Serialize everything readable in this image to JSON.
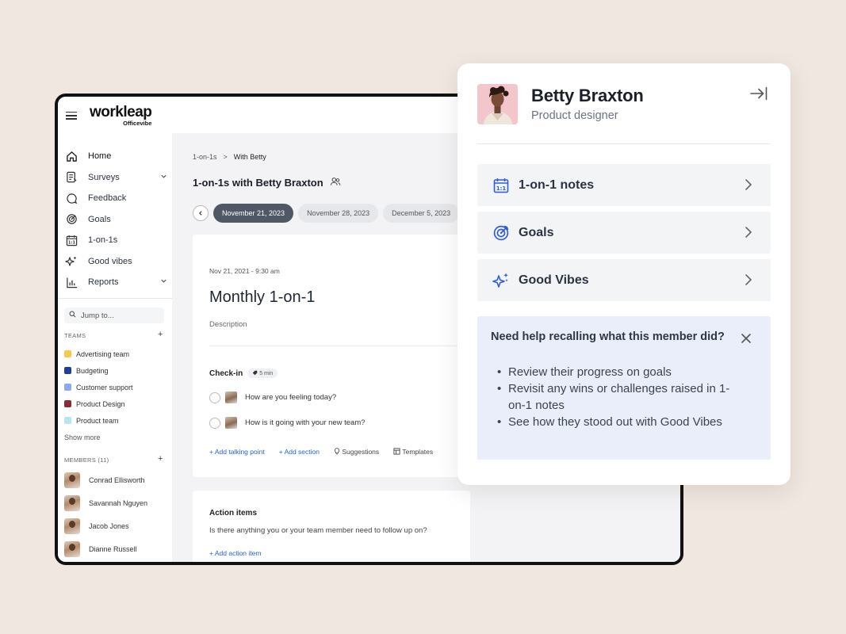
{
  "app": {
    "logo_main": "workleap",
    "logo_sub": "Officevibe"
  },
  "sidebar": {
    "nav": [
      {
        "label": "Home",
        "icon": "home-icon"
      },
      {
        "label": "Surveys",
        "icon": "survey-icon"
      },
      {
        "label": "Feedback",
        "icon": "feedback-icon"
      },
      {
        "label": "Goals",
        "icon": "target-icon"
      },
      {
        "label": "1-on-1s",
        "icon": "calendar-icon"
      },
      {
        "label": "Good vibes",
        "icon": "sparkles-icon"
      },
      {
        "label": "Reports",
        "icon": "bar-chart-icon"
      }
    ],
    "jump_placeholder": "Jump to...",
    "teams_title": "TEAMS",
    "teams": [
      {
        "label": "Advertising team",
        "color": "#f5c94a"
      },
      {
        "label": "Budgeting",
        "color": "#1f3f9e"
      },
      {
        "label": "Customer support",
        "color": "#8fa8f4"
      },
      {
        "label": "Product Design",
        "color": "#8e2a35"
      },
      {
        "label": "Product team",
        "color": "#b9e3ee"
      }
    ],
    "show_more": "Show more",
    "members_title": "MEMBERS (11)",
    "members": [
      "Conrad Ellisworth",
      "Savannah Nguyen",
      "Jacob Jones",
      "Dianne Russell"
    ]
  },
  "content": {
    "breadcrumb_root": "1-on-1s",
    "breadcrumb_sep": ">",
    "breadcrumb_current": "With Betty",
    "title": "1-on-1s with Betty Braxton",
    "dates": [
      "November 21, 2023",
      "November 28, 2023",
      "December 5, 2023"
    ],
    "meeting": {
      "meta": "Nov 21, 2021 - 9:30 am",
      "heading": "Monthly 1-on-1",
      "description": "Description",
      "checkin_label": "Check-in",
      "checkin_badge": "5 min",
      "questions": [
        "How are you feeling today?",
        "How is it going with your new team?"
      ],
      "add_talking_point": "+ Add talking point",
      "add_section": "+ Add section",
      "suggestions": "Suggestions",
      "templates": "Templates"
    },
    "action_items": {
      "heading": "Action items",
      "prompt": "Is there anything you or your team member need to follow up on?",
      "add": "+ Add action item"
    }
  },
  "panel": {
    "name": "Betty Braxton",
    "role": "Product designer",
    "rows": [
      {
        "label": "1-on-1 notes",
        "icon": "calendar-icon"
      },
      {
        "label": "Goals",
        "icon": "target-icon"
      },
      {
        "label": "Good Vibes",
        "icon": "sparkles-icon"
      }
    ],
    "help": {
      "title": "Need help recalling what this member did?",
      "items": [
        "Review their progress on goals",
        "Revisit any wins or challenges raised in 1-on-1 notes",
        "See how they stood out with Good Vibes"
      ]
    },
    "accent_color": "#2d5be3"
  }
}
